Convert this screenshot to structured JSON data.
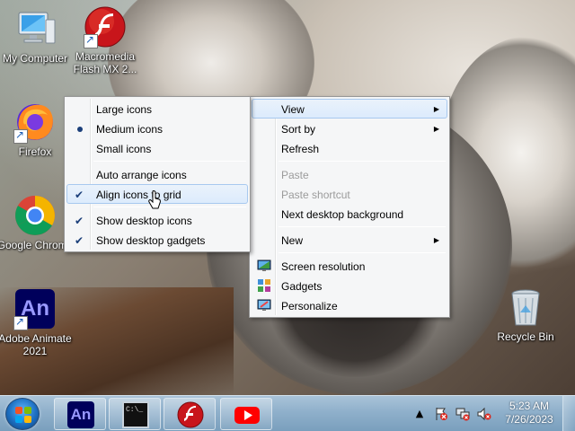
{
  "desktop": {
    "icons": [
      {
        "label": "My Computer",
        "icon": "computer-icon"
      },
      {
        "label": "Macromedia Flash MX 2...",
        "icon": "flash-icon"
      },
      {
        "label": "Firefox",
        "icon": "firefox-icon"
      },
      {
        "label": "Google Chrome",
        "icon": "chrome-icon"
      },
      {
        "label": "Adobe Animate 2021",
        "icon": "animate-icon",
        "glyph": "An"
      },
      {
        "label": "Recycle Bin",
        "icon": "recycle-bin-icon"
      }
    ]
  },
  "main_menu": {
    "items": [
      {
        "label": "View",
        "submenu": true,
        "highlighted": true
      },
      {
        "label": "Sort by",
        "submenu": true
      },
      {
        "label": "Refresh"
      },
      {
        "label": "Paste",
        "disabled": true
      },
      {
        "label": "Paste shortcut",
        "disabled": true
      },
      {
        "label": "Next desktop background"
      },
      {
        "label": "New",
        "submenu": true
      },
      {
        "label": "Screen resolution",
        "icon": "screen-resolution-icon"
      },
      {
        "label": "Gadgets",
        "icon": "gadgets-icon"
      },
      {
        "label": "Personalize",
        "icon": "personalize-icon"
      }
    ]
  },
  "view_submenu": {
    "items": [
      {
        "label": "Large icons"
      },
      {
        "label": "Medium icons",
        "selected": true
      },
      {
        "label": "Small icons"
      },
      {
        "label": "Auto arrange icons"
      },
      {
        "label": "Align icons to grid",
        "checked": true,
        "highlighted": true
      },
      {
        "label": "Show desktop icons",
        "checked": true
      },
      {
        "label": "Show desktop gadgets",
        "checked": true
      }
    ]
  },
  "taskbar": {
    "start_icon": "windows-start-icon",
    "pinned": [
      {
        "name": "Adobe Animate",
        "icon": "animate-taskbar-icon",
        "glyph": "An"
      },
      {
        "name": "Command Prompt",
        "icon": "cmd-taskbar-icon",
        "glyph": "C:\\_"
      },
      {
        "name": "Macromedia Flash",
        "icon": "flash-taskbar-icon"
      },
      {
        "name": "YouTube",
        "icon": "youtube-taskbar-icon"
      }
    ],
    "tray": {
      "time": "5:23 AM",
      "date": "7/26/2023",
      "icons": [
        "show-hidden-icons-icon",
        "action-center-icon",
        "network-icon",
        "volume-icon"
      ]
    }
  },
  "colors": {
    "menu_bg": "#f5f6f7",
    "menu_highlight": "#dcebfc",
    "taskbar": "#8fb0cb",
    "accent": "#1d6fc1"
  }
}
